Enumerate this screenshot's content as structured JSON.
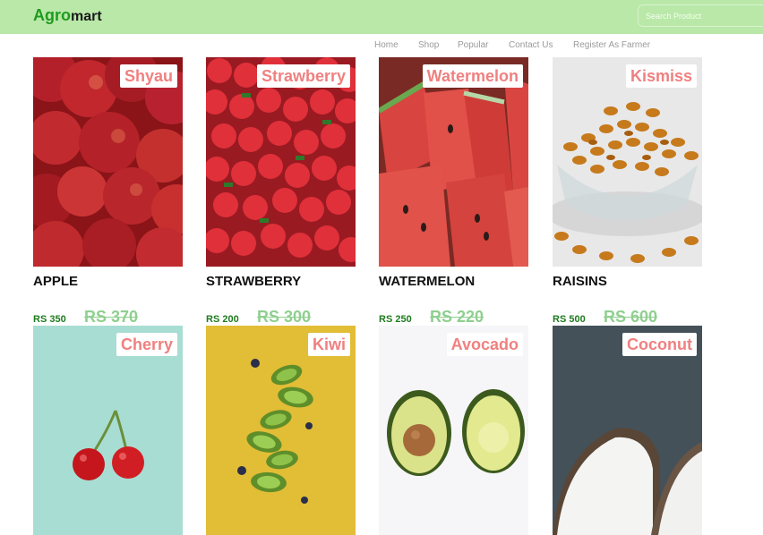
{
  "header": {
    "logo_primary": "Agro",
    "logo_secondary": "mart",
    "search_placeholder": "Search Product"
  },
  "nav": [
    "Home",
    "Shop",
    "Popular",
    "Contact Us",
    "Register As Farmer"
  ],
  "colors": {
    "header_bg": "#b9e8a8",
    "logo_green": "#1e9b1e",
    "tag_text": "#f08080",
    "price_green": "#1e7b1e",
    "old_price": "#8fcf8f"
  },
  "products": [
    {
      "tag": "Shyau",
      "name": "APPLE",
      "price": "RS 350",
      "old_price": "RS 370",
      "image": "apples"
    },
    {
      "tag": "Strawberry",
      "name": "STRAWBERRY",
      "price": "RS 200",
      "old_price": "RS 300",
      "image": "strawberries"
    },
    {
      "tag": "Watermelon",
      "name": "WATERMELON",
      "price": "RS 250",
      "old_price": "RS 220",
      "image": "watermelon-slices"
    },
    {
      "tag": "Kismiss",
      "name": "RAISINS",
      "price": "RS 500",
      "old_price": "RS 600",
      "image": "raisins-in-bowl"
    },
    {
      "tag": "Cherry",
      "image": "cherries-on-mint"
    },
    {
      "tag": "Kiwi",
      "image": "kiwi-slices-on-yellow"
    },
    {
      "tag": "Avocado",
      "image": "avocado-halves"
    },
    {
      "tag": "Coconut",
      "image": "coconut-on-dark"
    }
  ]
}
